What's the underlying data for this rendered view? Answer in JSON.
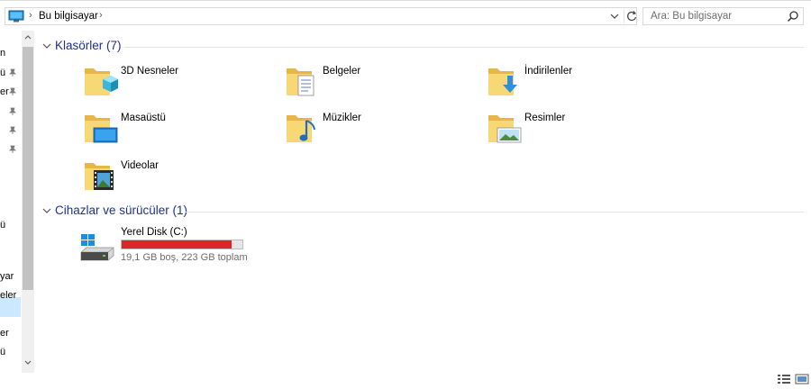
{
  "address_bar": {
    "location": "Bu bilgisayar",
    "pc_icon": "computer-icon"
  },
  "search": {
    "placeholder": "Ara: Bu bilgisayar"
  },
  "nav_fragments": [
    "n",
    "ü",
    "er",
    "",
    "",
    "",
    "ü",
    "yar",
    "eler",
    "er",
    "ü"
  ],
  "folders_group": {
    "title": "Klasörler (7)",
    "items": [
      {
        "label": "3D Nesneler",
        "icon": "3d-objects-folder-icon"
      },
      {
        "label": "Belgeler",
        "icon": "documents-folder-icon"
      },
      {
        "label": "İndirilenler",
        "icon": "downloads-folder-icon"
      },
      {
        "label": "Masaüstü",
        "icon": "desktop-folder-icon"
      },
      {
        "label": "Müzikler",
        "icon": "music-folder-icon"
      },
      {
        "label": "Resimler",
        "icon": "pictures-folder-icon"
      },
      {
        "label": "Videolar",
        "icon": "videos-folder-icon"
      }
    ]
  },
  "devices_group": {
    "title": "Cihazlar ve sürücüler (1)",
    "drive": {
      "label": "Yerel Disk (C:)",
      "free_text": "19,1 GB boş, 223 GB toplam",
      "used_fraction": 0.914,
      "bar_color": "#da2626",
      "icon": "windows-drive-icon"
    }
  },
  "colors": {
    "group_title": "#1e3287",
    "folder_yellow": "#f8d775",
    "selection": "#cce8ff"
  }
}
